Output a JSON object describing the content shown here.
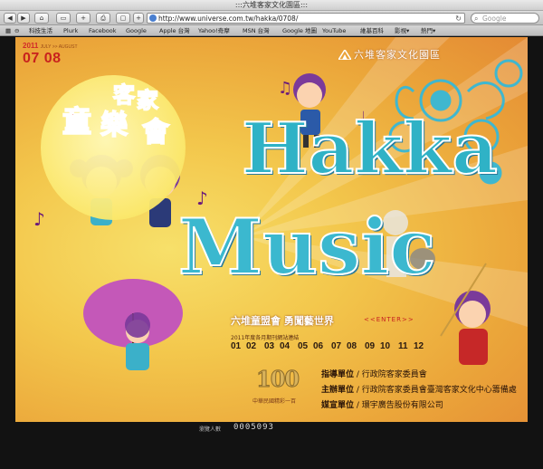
{
  "window": {
    "title": ":::六堆客家文化園區:::"
  },
  "toolbar": {
    "url": "http://www.universe.com.tw/hakka/0708/",
    "search_placeholder": "Google"
  },
  "bookmarks": [
    "科技生活",
    "Plurk",
    "Facebook",
    "Google",
    "Apple 台灣",
    "Yahoo!奇摩",
    "MSN 台灣",
    "Google 地圖",
    "YouTube",
    "維基百科",
    "影視▾",
    "熱門▾"
  ],
  "banner": {
    "date_small": "2011",
    "date_months": "JULY >> AUGUST",
    "date_big": "07 08",
    "org_name": "六堆客家文化園區",
    "logo_chars": [
      "客",
      "家",
      "童",
      "樂",
      "會"
    ],
    "hakka_word": "Hakka",
    "music_word": "Music",
    "slogan": "六堆童盟會 勇闖藝世界",
    "enter": "<<ENTER>>",
    "links_caption": "2011年度各月期刊網站連結",
    "issues": [
      "01",
      "02",
      "03",
      "04",
      "05",
      "06",
      "07",
      "08",
      "09",
      "10",
      "11",
      "12"
    ],
    "centennial_number": "100",
    "centennial_caption": "中華民國精彩一百",
    "credits": [
      {
        "label": "指導單位",
        "value": "行政院客家委員會"
      },
      {
        "label": "主辦單位",
        "value": "行政院客家委員會臺灣客家文化中心籌備處"
      },
      {
        "label": "媒宣單位",
        "value": "環宇廣告股份有限公司"
      }
    ]
  },
  "footer": {
    "counter_label": "瀏覽人數",
    "counter": "0005093"
  },
  "colors": {
    "accent_red": "#c8221e",
    "teal": "#2fb2c6",
    "banner_yellow": "#f3c74c"
  }
}
